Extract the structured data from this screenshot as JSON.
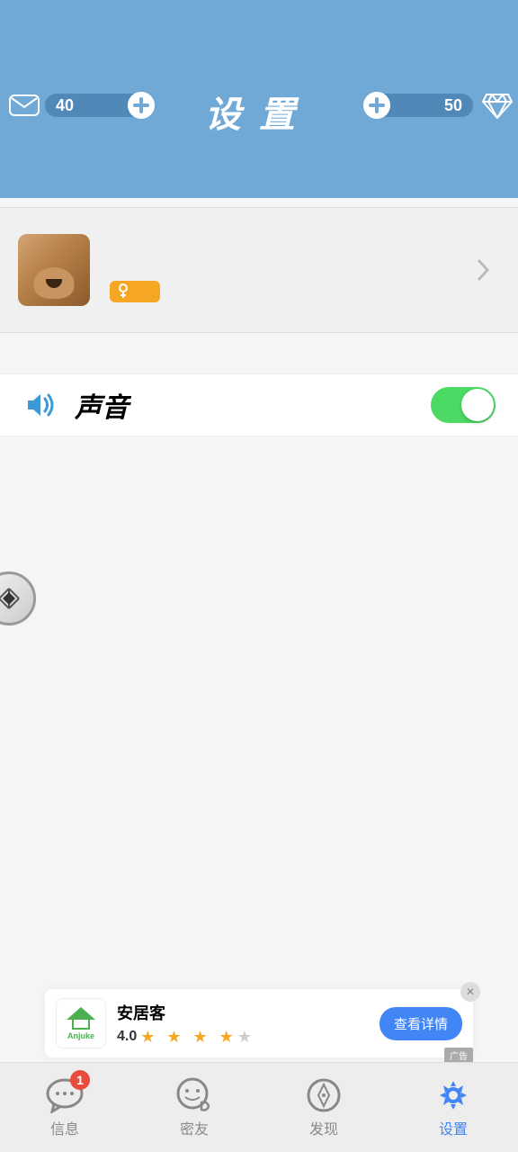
{
  "header": {
    "title": "设置",
    "coins_left": "40",
    "coins_right": "50"
  },
  "sound": {
    "label": "声音"
  },
  "ad": {
    "brand": "Anjuke",
    "title": "安居客",
    "score": "4.0",
    "button": "查看详情",
    "tag": "广告"
  },
  "tabs": {
    "messages": {
      "label": "信息",
      "badge": "1"
    },
    "friends": {
      "label": "密友"
    },
    "discover": {
      "label": "发现"
    },
    "settings": {
      "label": "设置"
    }
  }
}
